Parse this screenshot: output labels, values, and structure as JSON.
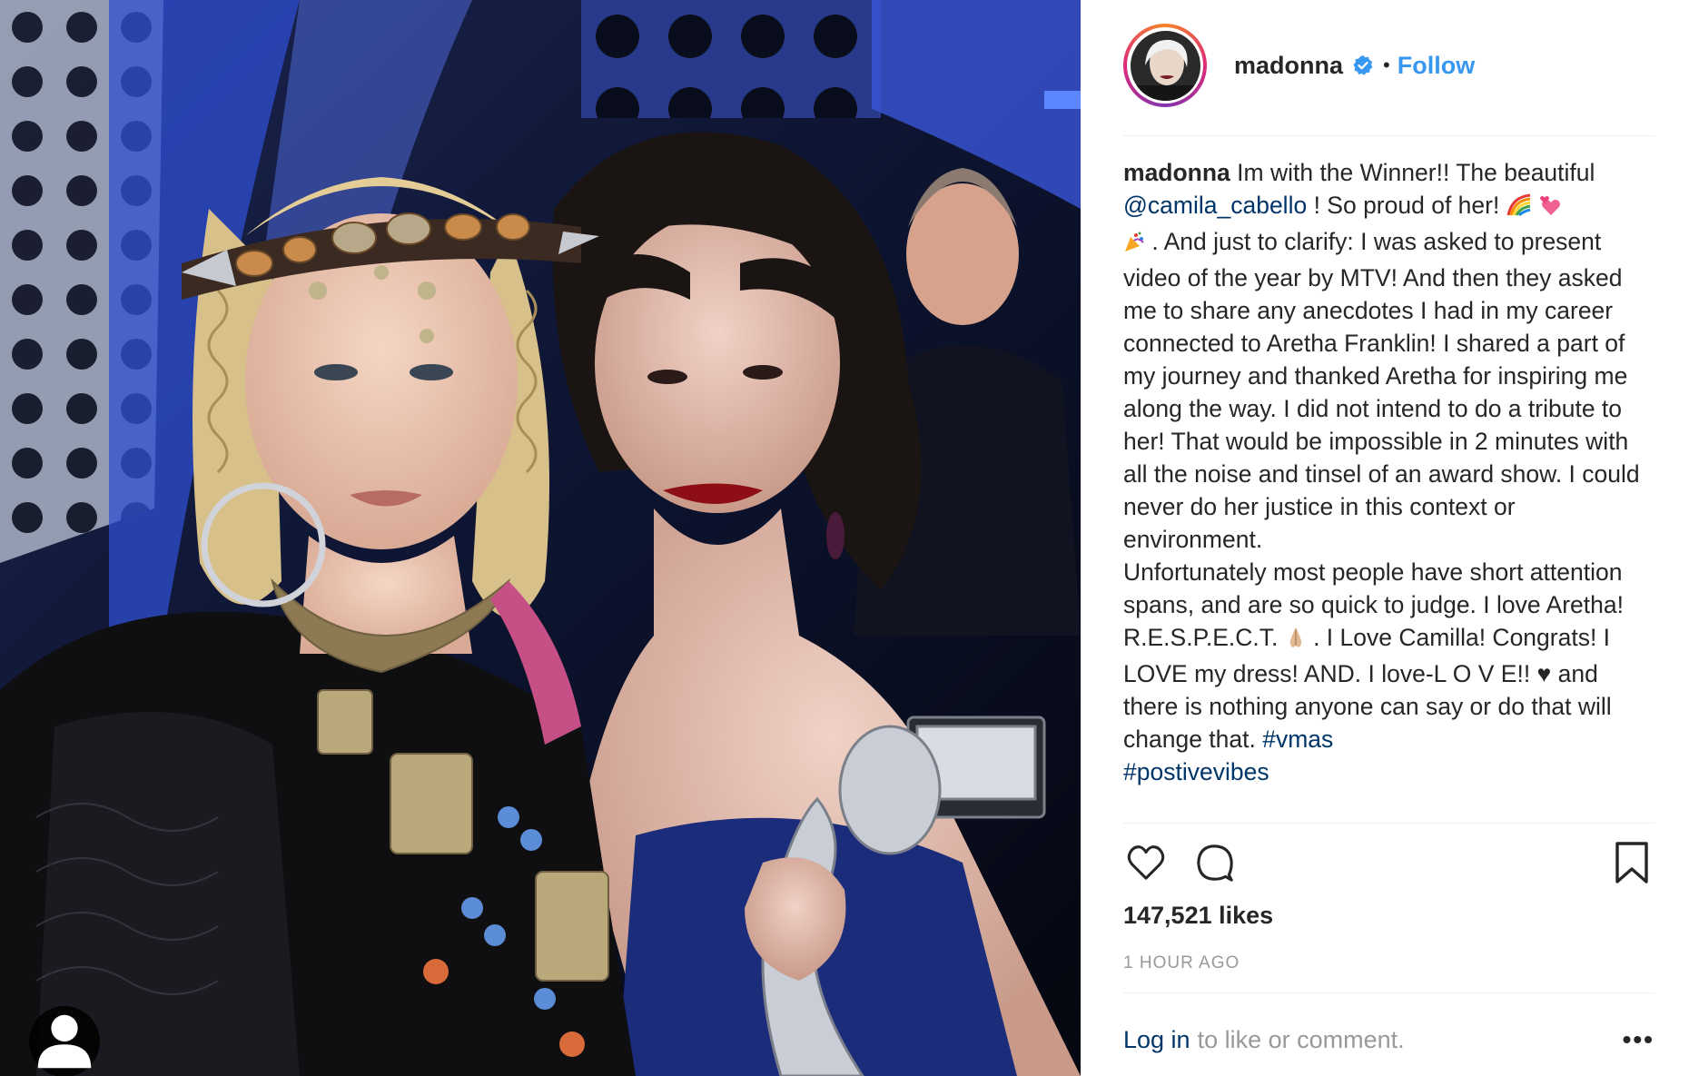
{
  "post": {
    "username": "madonna",
    "separator": "•",
    "follow_label": "Follow",
    "caption": {
      "username": "madonna",
      "text_1": " Im with the Winner!! The beautiful ",
      "mention": "@camila_cabello",
      "text_2": " ! So proud of her! ",
      "text_3": " . And just to clarify: I was asked to present video of the year by MTV! And then they asked me to share any anecdotes I had in my career connected to Aretha Franklin! I shared a part of my journey and thanked Aretha for inspiring me along the way. I did not intend to do a tribute to her! That would be impossible in 2 minutes with all the noise and tinsel of an award show. I could never do her justice in this context or environment.",
      "text_4": "Unfortunately most people have short attention spans, and are so quick to judge. I love Aretha! R.E.S.P.E.C.T. ",
      "text_5": " . I Love Camilla! Congrats! I LOVE my dress! AND. I love-L O V E!! ♥ and there is nothing anyone can say or do that will change that. ",
      "hashtag_1": "#vmas",
      "hashtag_2": "#postivevibes"
    },
    "likes": "147,521 likes",
    "time_ago": "1 HOUR AGO",
    "login_link": "Log in",
    "login_rest": "to like or comment.",
    "more_label": "•••"
  },
  "colors": {
    "link": "#003569",
    "follow": "#3897f0",
    "muted": "#999999",
    "text": "#262626"
  },
  "icons": [
    "verified-badge-icon",
    "heart-icon",
    "comment-icon",
    "bookmark-icon",
    "user-tag-icon",
    "more-icon"
  ]
}
